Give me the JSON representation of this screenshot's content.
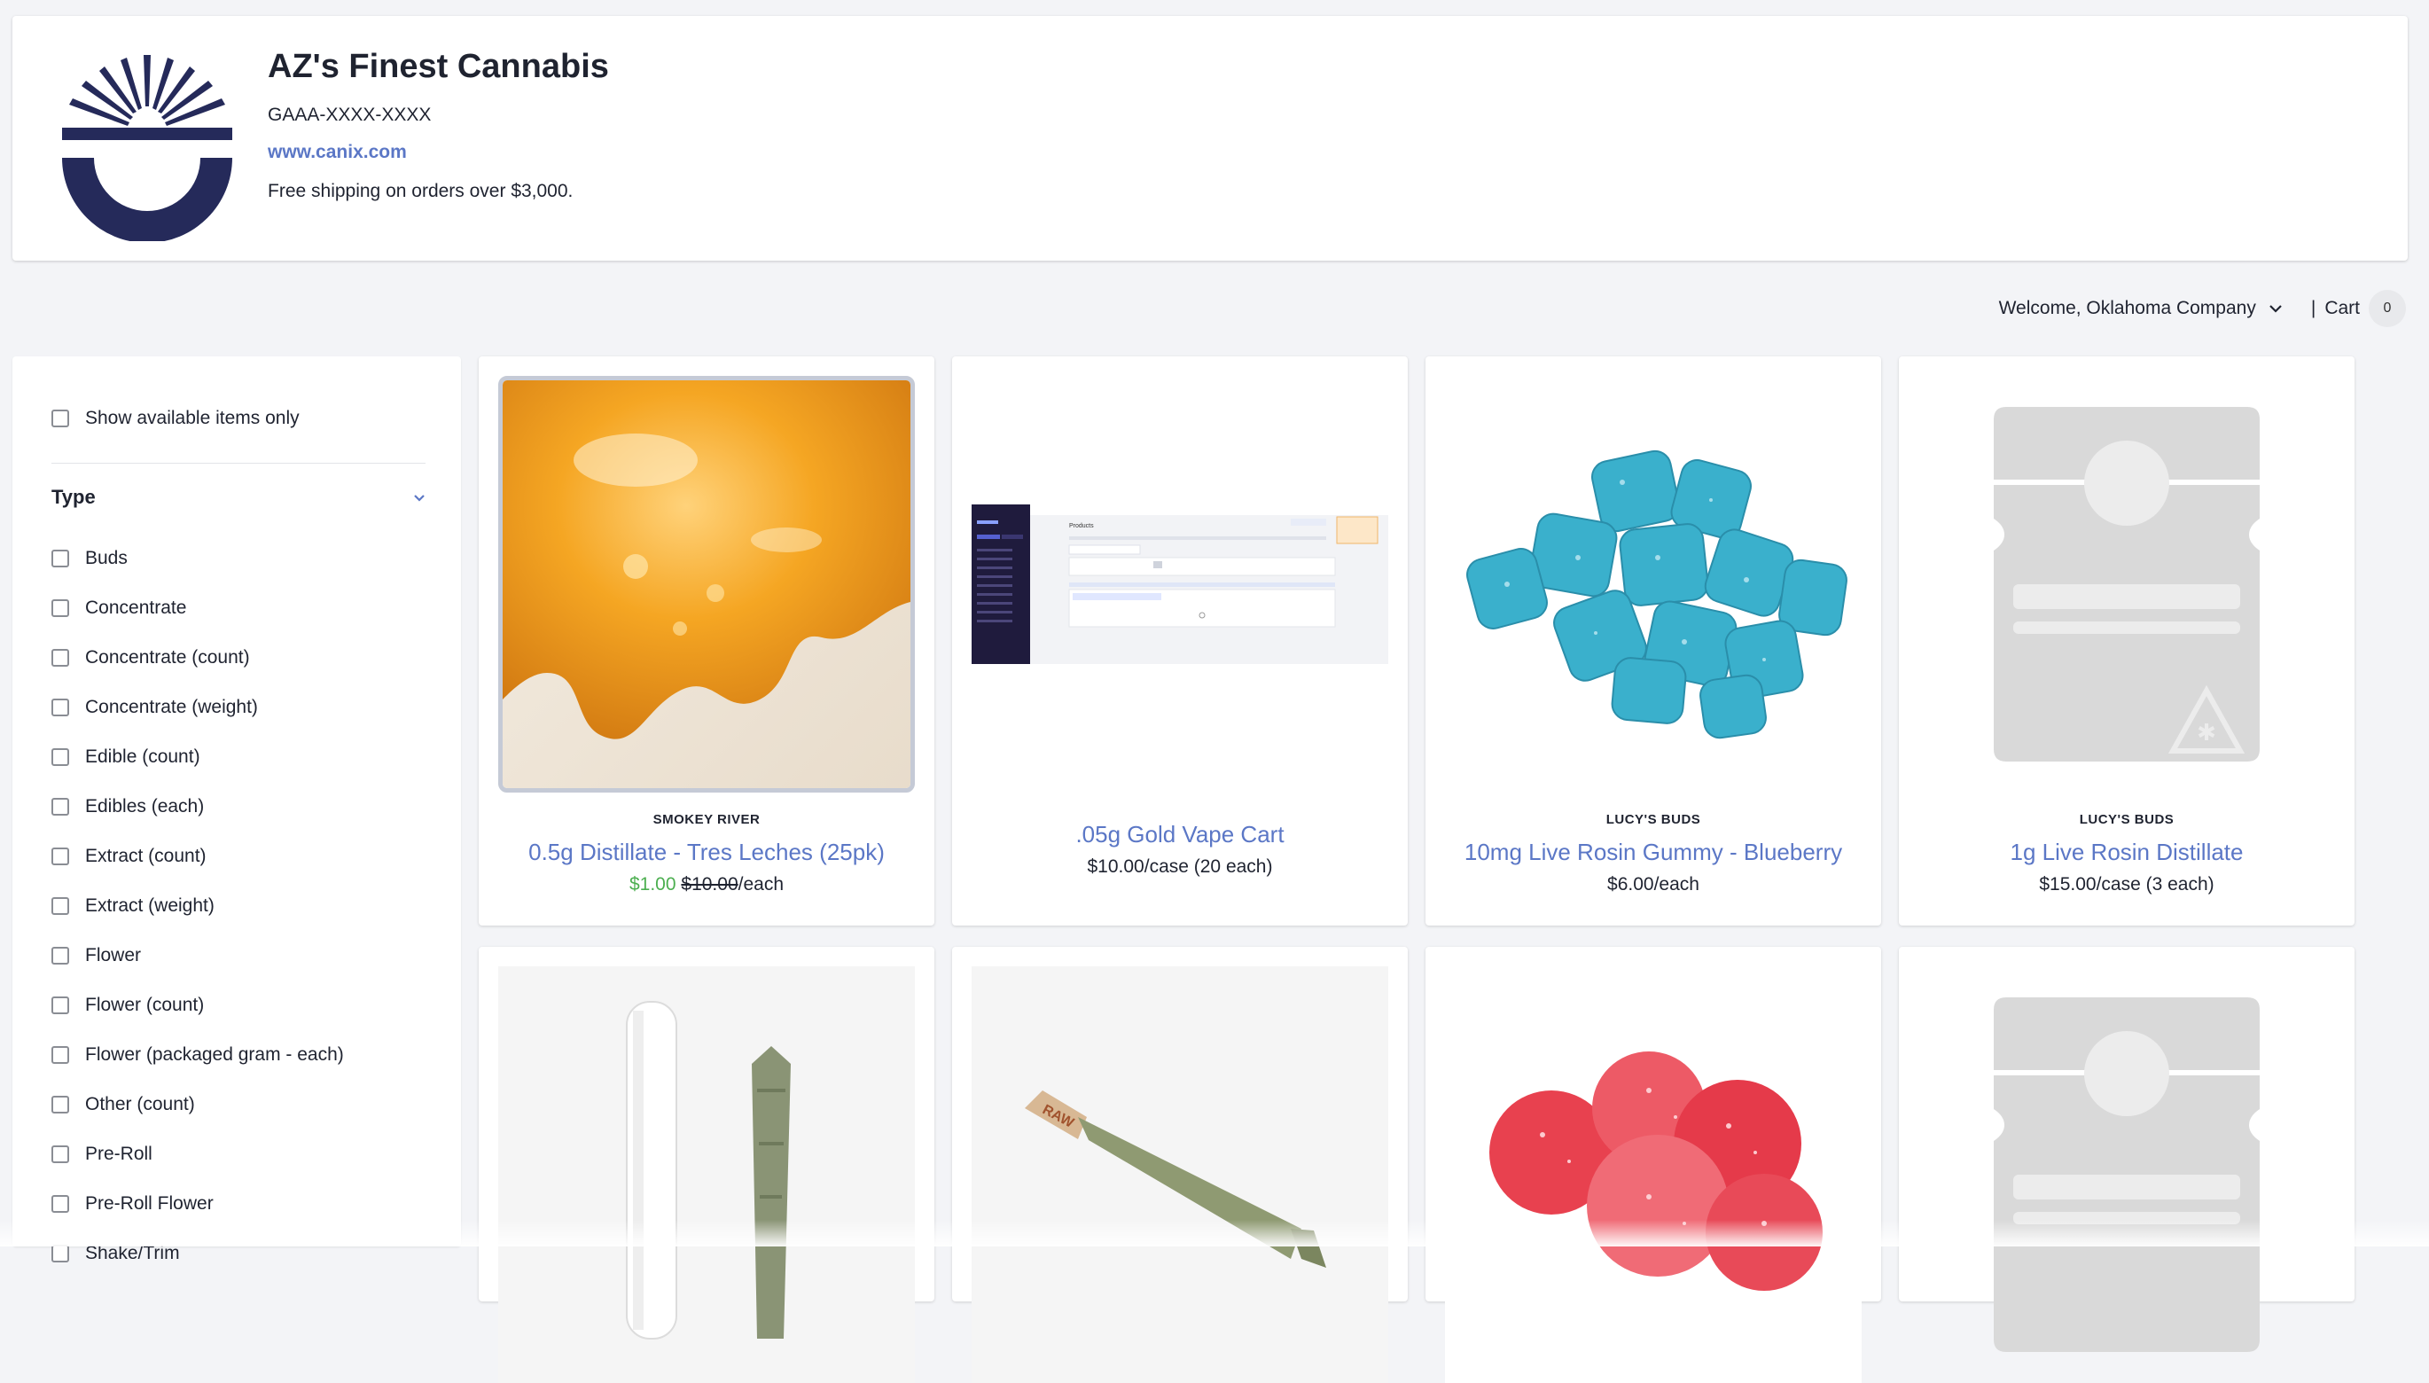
{
  "store": {
    "name": "AZ's Finest Cannabis",
    "license": "GAAA-XXXX-XXXX",
    "website": "www.canix.com",
    "shipping_note": "Free shipping on orders over $3,000."
  },
  "userbar": {
    "welcome": "Welcome, Oklahoma Company",
    "separator": "|",
    "cart_label": "Cart",
    "cart_count": "0"
  },
  "filters": {
    "available_only": "Show available items only",
    "type_heading": "Type",
    "types": [
      "Buds",
      "Concentrate",
      "Concentrate (count)",
      "Concentrate (weight)",
      "Edible (count)",
      "Edibles (each)",
      "Extract (count)",
      "Extract (weight)",
      "Flower",
      "Flower (count)",
      "Flower (packaged gram - each)",
      "Other (count)",
      "Pre-Roll",
      "Pre-Roll Flower",
      "Shake/Trim"
    ]
  },
  "products": [
    {
      "brand": "SMOKEY RIVER",
      "name": "0.5g Distillate - Tres Leches (25pk)",
      "sale_price": "$1.00",
      "original_price": "$10.00",
      "unit": "/each"
    },
    {
      "brand": "",
      "name": ".05g Gold Vape Cart",
      "price": "$10.00/case (20 each)"
    },
    {
      "brand": "LUCY'S BUDS",
      "name": "10mg Live Rosin Gummy - Blueberry",
      "price": "$6.00/each"
    },
    {
      "brand": "LUCY'S BUDS",
      "name": "1g Live Rosin Distillate",
      "price": "$15.00/case (3 each)"
    }
  ],
  "screenshot_preview": {
    "title": "Products"
  },
  "colors": {
    "accent": "#5b77c6",
    "sale": "#4caf50",
    "logo": "#252a5a",
    "background": "#f3f4f7"
  }
}
